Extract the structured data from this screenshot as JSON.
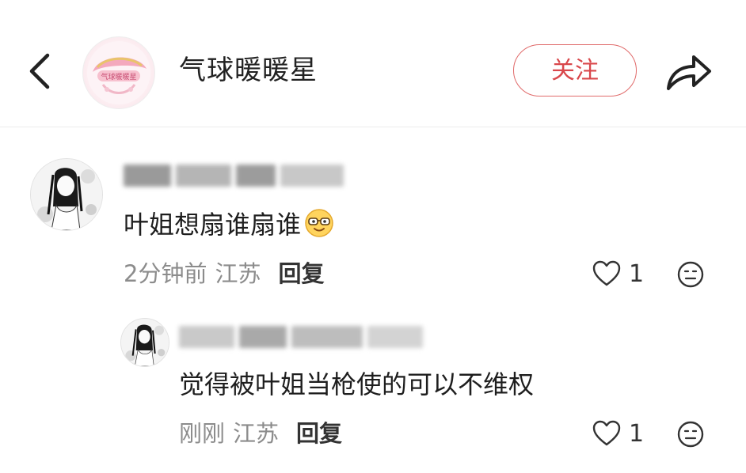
{
  "header": {
    "title": "气球暖暖星",
    "follow_label": "关注",
    "back_icon": "chevron-left-icon",
    "share_icon": "share-arrow-icon",
    "avatar_logo_text": "气球暖暖星"
  },
  "comments": [
    {
      "text": "叶姐想扇谁扇谁",
      "emoji": "sunglasses-emoji",
      "time": "2分钟前",
      "location": "江苏",
      "reply_label": "回复",
      "likes": "1"
    }
  ],
  "replies": [
    {
      "text": "觉得被叶姐当枪使的可以不维权",
      "time": "刚刚",
      "location": "江苏",
      "reply_label": "回复",
      "likes": "1"
    }
  ],
  "colors": {
    "accent": "#d9474b",
    "muted_text": "#8c8c8c",
    "divider": "#ececec"
  }
}
